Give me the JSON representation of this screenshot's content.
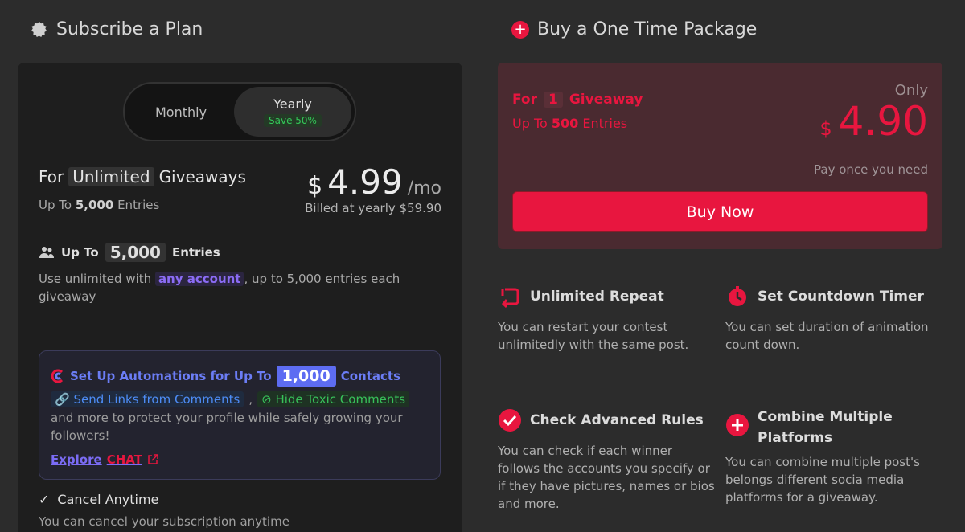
{
  "subscribe": {
    "title": "Subscribe a Plan",
    "toggle": {
      "monthly": "Monthly",
      "yearly": "Yearly",
      "save_badge": "Save 50%"
    },
    "plan": {
      "for_prefix": "For",
      "for_highlight": "Unlimited",
      "for_suffix": "Giveaways",
      "entries_prefix": "Up To",
      "entries_value": "5,000",
      "entries_suffix": "Entries",
      "currency": "$",
      "price": "4.99",
      "period": "/mo",
      "billed": "Billed at yearly $59.90"
    },
    "entries_feature": {
      "prefix": "Up To",
      "value": "5,000",
      "suffix": "Entries",
      "desc_prefix": "Use unlimited with",
      "desc_highlight": "any account",
      "desc_suffix": ", up to 5,000 entries each giveaway"
    },
    "automation": {
      "title_prefix": "Set Up Automations for Up To",
      "title_value": "1,000",
      "title_suffix": "Contacts",
      "link_send": "Send Links from Comments",
      "separator": ",",
      "link_hide": "Hide Toxic Comments",
      "desc": "and more to protect your profile while safely growing your followers!",
      "explore_prefix": "Explore",
      "explore_chat": "CHAT"
    },
    "cancel": {
      "title": "Cancel Anytime",
      "desc": "You can cancel your subscription anytime"
    }
  },
  "onetime": {
    "title": "Buy a One Time Package",
    "for_prefix": "For",
    "for_value": "1",
    "for_suffix": "Giveaway",
    "entries_prefix": "Up To",
    "entries_value": "500",
    "entries_suffix": "Entries",
    "only": "Only",
    "currency": "$",
    "price": "4.90",
    "pay_note": "Pay once you need",
    "buy_label": "Buy Now"
  },
  "features": {
    "repeat": {
      "title": "Unlimited Repeat",
      "desc": "You can restart your contest unlimitedly with the same post."
    },
    "timer": {
      "title": "Set Countdown Timer",
      "desc": "You can set duration of animation count down."
    },
    "rules": {
      "title": "Check Advanced Rules",
      "desc": "You can check if each winner follows the accounts you specify or if they have pictures, names or bios and more."
    },
    "combine": {
      "title": "Combine Multiple Platforms",
      "desc": "You can combine multiple post's belongs different socia media platforms for a giveaway."
    }
  },
  "colors": {
    "accent": "#e8163f",
    "purple": "#6b7df5",
    "green": "#38c15a",
    "background": "#2c2c2c"
  }
}
